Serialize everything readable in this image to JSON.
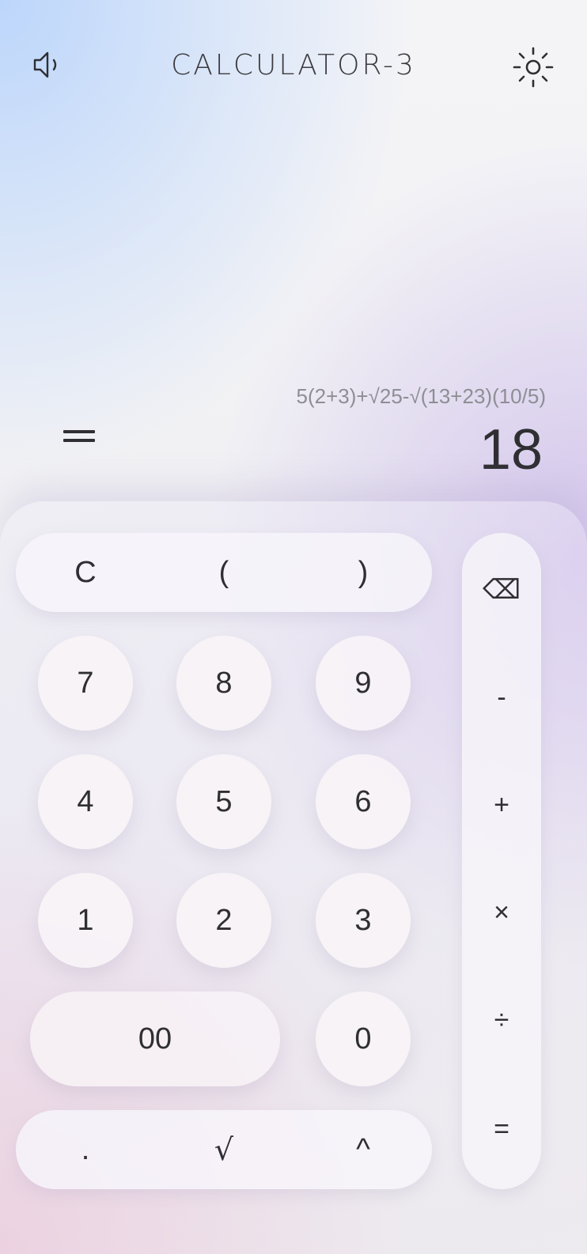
{
  "header": {
    "title": "CALCULATOR-3",
    "sound_icon": "speaker-icon",
    "theme_icon": "sun-icon"
  },
  "display": {
    "expression": "5(2+3)+√25-√(13+23)(10/5)",
    "result": "18",
    "history_icon": "equals-menu-icon"
  },
  "keypad": {
    "top_row": [
      "C",
      "(",
      ")"
    ],
    "digits": [
      [
        "7",
        "8",
        "9"
      ],
      [
        "4",
        "5",
        "6"
      ],
      [
        "1",
        "2",
        "3"
      ]
    ],
    "double_zero": "00",
    "zero": "0",
    "bottom_row": [
      ".",
      "√",
      "^"
    ],
    "operators": [
      "⌫",
      "-",
      "+",
      "×",
      "÷",
      "="
    ]
  },
  "colors": {
    "text": "#2f2f33",
    "expression": "#8e8e94",
    "accent_blue": "#bcd6fb",
    "accent_purple": "#d3c5ec",
    "accent_pink": "#ecc8d8"
  }
}
